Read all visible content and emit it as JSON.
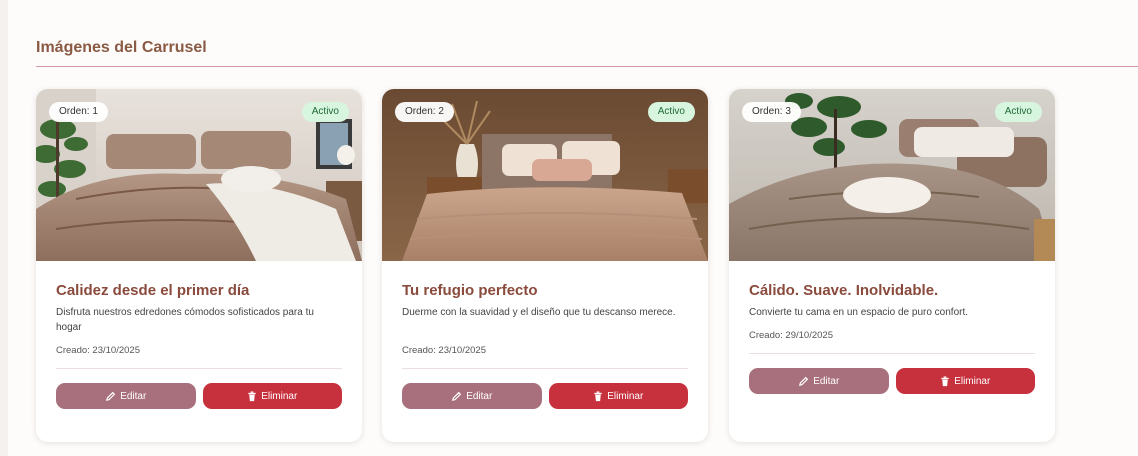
{
  "section": {
    "title": "Imágenes del Carrusel"
  },
  "cards": [
    {
      "order": "Orden: 1",
      "status": "Activo",
      "title": "Calidez desde el primer día",
      "description": "Disfruta nuestros edredones cómodos sofisticados para tu hogar",
      "created": "Creado: 23/10/2025",
      "edit_label": "Editar",
      "delete_label": "Eliminar"
    },
    {
      "order": "Orden: 2",
      "status": "Activo",
      "title": "Tu refugio perfecto",
      "description": "Duerme con la suavidad y el diseño que tu descanso merece.",
      "created": "Creado: 23/10/2025",
      "edit_label": "Editar",
      "delete_label": "Eliminar"
    },
    {
      "order": "Orden: 3",
      "status": "Activo",
      "title": "Cálido. Suave. Inolvidable.",
      "description": "Convierte tu cama en un espacio de puro confort.",
      "created": "Creado: 29/10/2025",
      "edit_label": "Editar",
      "delete_label": "Eliminar"
    }
  ],
  "colors": {
    "title": "#8a5a44",
    "card_title": "#8a4a3c",
    "edit_button": "#a8707c",
    "delete_button": "#c7303d",
    "status_bg": "#d8f5df",
    "status_text": "#1e6b36"
  },
  "icons": {
    "edit": "pencil-icon",
    "delete": "trash-icon"
  }
}
